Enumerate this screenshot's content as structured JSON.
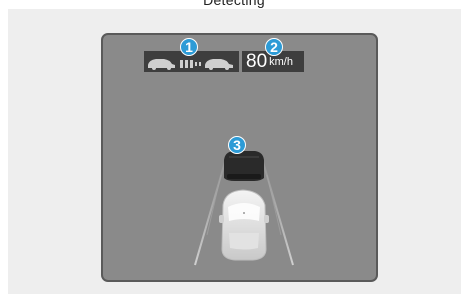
{
  "caption": "Detecting",
  "display": {
    "speed": {
      "value": "80",
      "unit": "km/h"
    },
    "callouts": [
      {
        "number": "1"
      },
      {
        "number": "2"
      },
      {
        "number": "3"
      }
    ],
    "icons": {
      "distance": "vehicle-distance-icon",
      "lead_vehicle": "preceding-vehicle-icon",
      "own_vehicle": "own-car-icon"
    },
    "colors": {
      "screen_bg": "#8a8a8a",
      "panel_bg": "#3e3e3e",
      "callout": "#2d9bd6"
    }
  }
}
